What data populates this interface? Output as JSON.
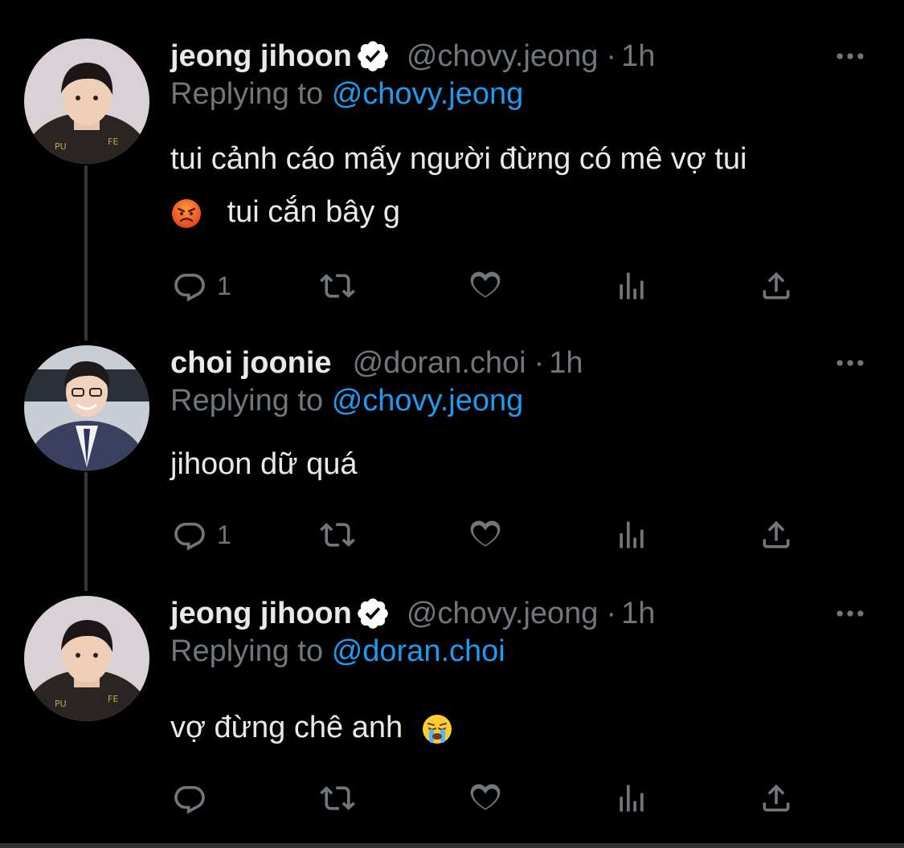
{
  "tweets": [
    {
      "name": "jeong jihoon",
      "verified": true,
      "handle": "@chovy.jeong",
      "separator": "·",
      "time": "1h",
      "replying_prefix": "Replying to",
      "replying_to": "@chovy.jeong",
      "line1": "tui cảnh cáo mấy người đừng có mê vợ tui",
      "line2": "tui cắn bây g",
      "line2_emoji": "angry-face-emoji",
      "reply_count": "1"
    },
    {
      "name": "choi joonie",
      "verified": false,
      "handle": "@doran.choi",
      "separator": "·",
      "time": "1h",
      "replying_prefix": "Replying to",
      "replying_to": "@chovy.jeong",
      "line1": "jihoon dữ quá",
      "reply_count": "1"
    },
    {
      "name": "jeong jihoon",
      "verified": true,
      "handle": "@chovy.jeong",
      "separator": "·",
      "time": "1h",
      "replying_prefix": "Replying to",
      "replying_to": "@doran.choi",
      "line1": "vợ đừng chê anh",
      "line1_emoji": "crying-face-emoji",
      "reply_count": ""
    }
  ],
  "icons": [
    "reply-icon",
    "retweet-icon",
    "like-icon",
    "views-icon",
    "share-icon",
    "more-icon",
    "verified-badge-icon"
  ],
  "colors": {
    "background": "#000000",
    "text": "#e7e9ea",
    "secondary": "#71767b",
    "link": "#1d9bf0",
    "thread_line": "#333639"
  }
}
